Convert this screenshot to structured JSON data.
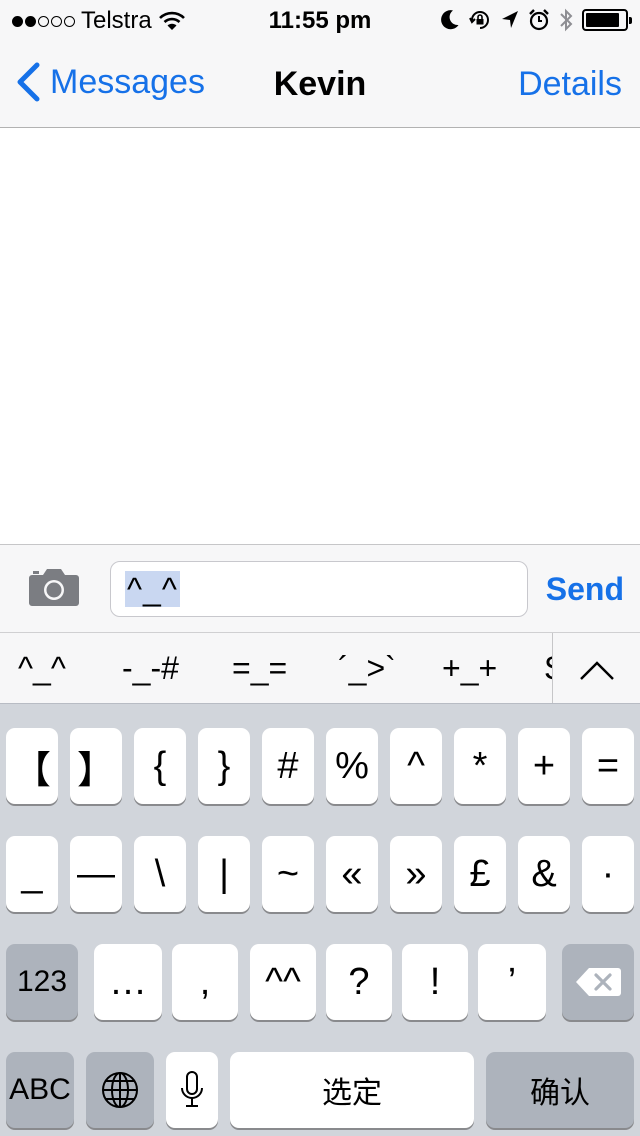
{
  "status_bar": {
    "carrier": "Telstra",
    "time": "11:55 pm"
  },
  "nav": {
    "back_label": "Messages",
    "title": "Kevin",
    "details_label": "Details"
  },
  "composer": {
    "text": "^_^",
    "send_label": "Send"
  },
  "candidates": [
    "^_^",
    "-_-#",
    "=_=",
    "´_>`",
    "+_+",
    "S"
  ],
  "keyboard": {
    "row1": [
      "【",
      "】",
      "{",
      "}",
      "#",
      "%",
      "^",
      "*",
      "+",
      "="
    ],
    "row2": [
      "_",
      "—",
      "\\",
      "|",
      "~",
      "«",
      "»",
      "£",
      "&",
      "·"
    ],
    "row3": [
      "123",
      "…",
      ",",
      "^^",
      "?",
      "!",
      "’"
    ],
    "row4": {
      "abc": "ABC",
      "space": "选定",
      "confirm": "确认"
    }
  },
  "colors": {
    "accent": "#1671e8",
    "keyboard_bg": "#d1d5db",
    "dark_key": "#adb3bc"
  }
}
